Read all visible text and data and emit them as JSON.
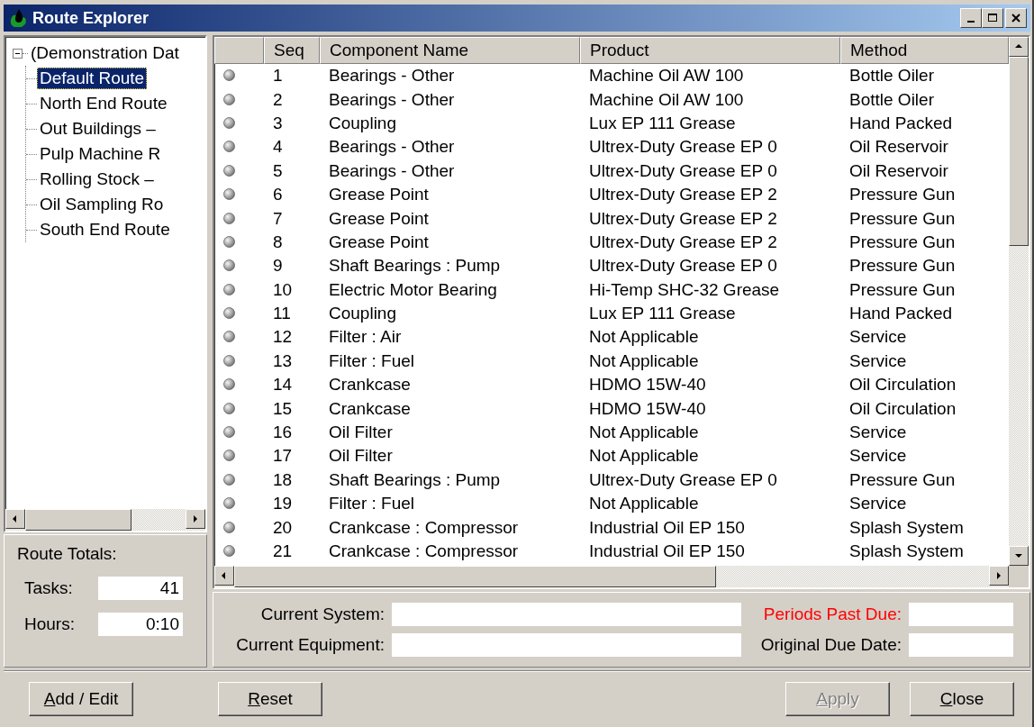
{
  "window": {
    "title": "Route Explorer"
  },
  "tree": {
    "label": "(Demonstration Dat",
    "expanded": true,
    "children": [
      {
        "label": "Default Route",
        "selected": true
      },
      {
        "label": "North End Route",
        "selected": false
      },
      {
        "label": "Out Buildings –",
        "selected": false
      },
      {
        "label": "Pulp Machine R",
        "selected": false
      },
      {
        "label": "Rolling Stock –",
        "selected": false
      },
      {
        "label": "Oil Sampling Ro",
        "selected": false
      },
      {
        "label": "South End Route",
        "selected": false
      }
    ]
  },
  "totals": {
    "title": "Route Totals:",
    "fields": [
      {
        "label": "Tasks:",
        "value": "41"
      },
      {
        "label": "Hours:",
        "value": "0:10"
      }
    ]
  },
  "table": {
    "columns": [
      "Seq",
      "Component Name",
      "Product",
      "Method"
    ],
    "rows": [
      {
        "seq": "1",
        "component": "Bearings - Other",
        "product": "Machine Oil AW 100",
        "method": "Bottle Oiler"
      },
      {
        "seq": "2",
        "component": "Bearings - Other",
        "product": "Machine Oil AW 100",
        "method": "Bottle Oiler"
      },
      {
        "seq": "3",
        "component": "Coupling",
        "product": "Lux EP 111 Grease",
        "method": "Hand Packed"
      },
      {
        "seq": "4",
        "component": "Bearings - Other",
        "product": "Ultrex-Duty Grease EP 0",
        "method": "Oil Reservoir"
      },
      {
        "seq": "5",
        "component": "Bearings - Other",
        "product": "Ultrex-Duty Grease EP 0",
        "method": "Oil Reservoir"
      },
      {
        "seq": "6",
        "component": "Grease Point",
        "product": "Ultrex-Duty Grease EP 2",
        "method": "Pressure Gun"
      },
      {
        "seq": "7",
        "component": "Grease Point",
        "product": "Ultrex-Duty Grease EP 2",
        "method": "Pressure Gun"
      },
      {
        "seq": "8",
        "component": "Grease Point",
        "product": "Ultrex-Duty Grease EP 2",
        "method": "Pressure Gun"
      },
      {
        "seq": "9",
        "component": "Shaft Bearings : Pump",
        "product": "Ultrex-Duty Grease EP 0",
        "method": "Pressure Gun"
      },
      {
        "seq": "10",
        "component": "Electric Motor Bearing",
        "product": "Hi-Temp SHC-32 Grease",
        "method": "Pressure Gun"
      },
      {
        "seq": "11",
        "component": "Coupling",
        "product": "Lux EP 111 Grease",
        "method": "Hand Packed"
      },
      {
        "seq": "12",
        "component": "Filter : Air",
        "product": "Not Applicable",
        "method": "Service"
      },
      {
        "seq": "13",
        "component": "Filter : Fuel",
        "product": "Not Applicable",
        "method": "Service"
      },
      {
        "seq": "14",
        "component": "Crankcase",
        "product": "HDMO 15W-40",
        "method": "Oil Circulation"
      },
      {
        "seq": "15",
        "component": "Crankcase",
        "product": "HDMO 15W-40",
        "method": "Oil Circulation"
      },
      {
        "seq": "16",
        "component": "Oil Filter",
        "product": "Not Applicable",
        "method": "Service"
      },
      {
        "seq": "17",
        "component": "Oil Filter",
        "product": "Not Applicable",
        "method": "Service"
      },
      {
        "seq": "18",
        "component": "Shaft Bearings : Pump",
        "product": "Ultrex-Duty Grease EP 0",
        "method": "Pressure Gun"
      },
      {
        "seq": "19",
        "component": "Filter : Fuel",
        "product": "Not Applicable",
        "method": "Service"
      },
      {
        "seq": "20",
        "component": "Crankcase : Compressor",
        "product": "Industrial Oil EP 150",
        "method": "Splash System"
      },
      {
        "seq": "21",
        "component": "Crankcase : Compressor",
        "product": "Industrial Oil EP 150",
        "method": "Splash System"
      }
    ]
  },
  "details": [
    {
      "label": "Current System:",
      "alert": false
    },
    {
      "label": "Periods Past Due:",
      "alert": true
    },
    {
      "label": "Current Equipment:",
      "alert": false
    },
    {
      "label": "Original Due Date:",
      "alert": false
    }
  ],
  "buttons": [
    {
      "label": "Add / Edit",
      "disabled": false
    },
    {
      "label": "Reset",
      "disabled": false
    },
    {
      "label": "Apply",
      "disabled": true
    },
    {
      "label": "Close",
      "disabled": false
    }
  ]
}
